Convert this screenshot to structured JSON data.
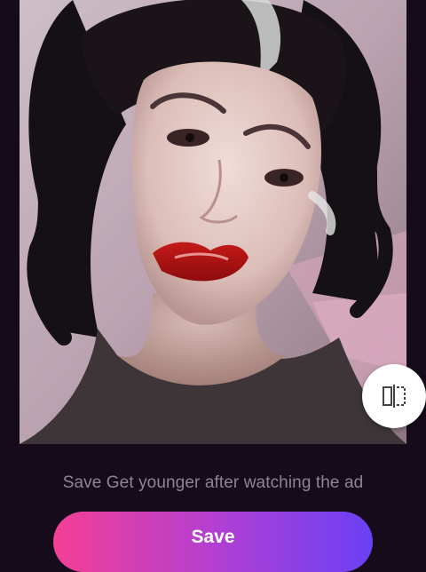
{
  "photo": {
    "icon": "portrait-photo"
  },
  "compare": {
    "icon": "compare-split-icon"
  },
  "caption": {
    "text": "Save Get younger after watching the ad"
  },
  "save": {
    "label": "Save"
  },
  "colors": {
    "background": "#150b1b",
    "button_gradient_start": "#f43f94",
    "button_gradient_end": "#6a40f5",
    "caption": "#8e8594"
  }
}
